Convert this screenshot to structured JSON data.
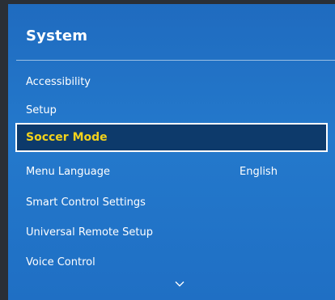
{
  "menu": {
    "title": "System",
    "items": [
      {
        "label": "Accessibility"
      },
      {
        "label": "Setup"
      },
      {
        "label": "Soccer Mode"
      },
      {
        "label": "Menu Language",
        "value": "English"
      },
      {
        "label": "Smart Control Settings"
      },
      {
        "label": "Universal Remote Setup"
      },
      {
        "label": "Voice Control"
      }
    ],
    "selected_index": 2,
    "more_indicator_icon": "chevron-down-icon"
  },
  "colors": {
    "panel_blue": "#2479cc",
    "selected_bg": "#0d3a6b",
    "selected_text": "#f3d21b",
    "border_white": "#ffffff",
    "outer_bg": "#2a2f36"
  }
}
